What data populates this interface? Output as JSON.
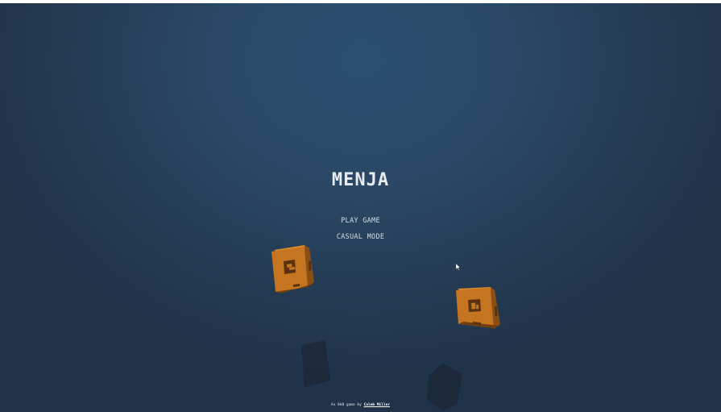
{
  "game": {
    "title": "MENJA",
    "menu": {
      "play_label": "PLAY GAME",
      "casual_label": "CASUAL MODE"
    },
    "footer": {
      "prefix": "An 8kB game by",
      "author": "Caleb Miller"
    }
  },
  "colors": {
    "background_center": "#2c4f70",
    "background_edge": "#1f3247",
    "cube_front": "#c5751f",
    "cube_side": "#8a4e14",
    "cube_top": "#d98a2e",
    "shadow": "#1c2838",
    "text": "#e8ecf0"
  },
  "icons": {
    "cube": "orange-cube-icon",
    "cursor": "mouse-pointer-icon"
  }
}
